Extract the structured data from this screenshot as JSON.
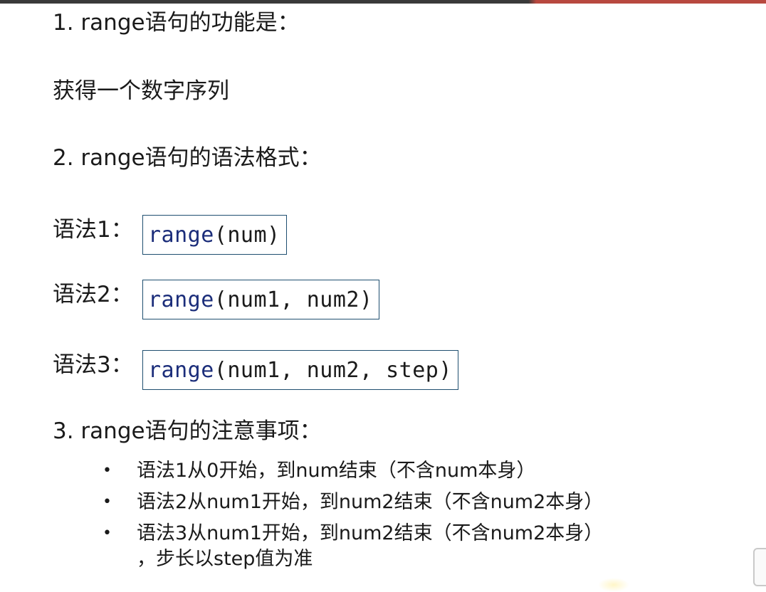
{
  "heading1": "1. range语句的功能是：",
  "paragraph1": "获得一个数字序列",
  "heading2": "2. range语句的语法格式：",
  "syntax": [
    {
      "label": "语法1：",
      "fn": "range",
      "args": "(num)"
    },
    {
      "label": "语法2：",
      "fn": "range",
      "args": "(num1, num2)"
    },
    {
      "label": "语法3：",
      "fn": "range",
      "args": "(num1, num2, step)"
    }
  ],
  "heading3": "3. range语句的注意事项：",
  "bullet_symbol": "•",
  "notes": [
    {
      "text": "语法1从0开始，到num结束（不含num本身）"
    },
    {
      "text": "语法2从num1开始，到num2结束（不含num2本身）"
    },
    {
      "text": "语法3从num1开始，到num2结束（不含num2本身）",
      "continuation": "，步长以step值为准"
    }
  ],
  "colors": {
    "code_keyword": "#1b2d7a",
    "box_border": "#1f4f70",
    "text": "#1a1a1a"
  }
}
